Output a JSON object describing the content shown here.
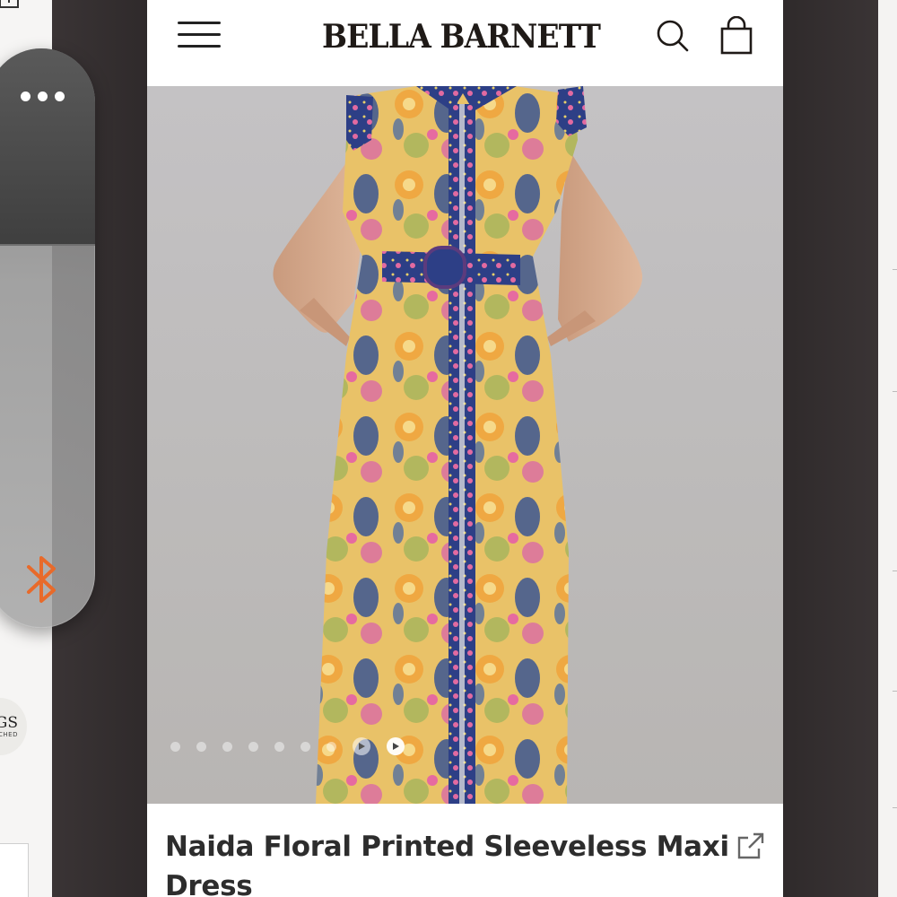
{
  "site": {
    "brand_name": "BELLA BARNETT"
  },
  "product": {
    "title": "Naida Floral Printed Sleeveless Maxi Dress",
    "gallery": {
      "image_alt": "Model wearing floral printed sleeveless maxi dress with belt",
      "total_images": 7,
      "video_items": 2
    }
  },
  "background_app": {
    "badge_main": "GS",
    "badge_sub": "CHED"
  },
  "colors": {
    "brand_text": "#1f1a17",
    "bluetooth_accent": "#e86a2a",
    "page_bg": "#ffffff",
    "gallery_bg": "#bfbdbc"
  },
  "icons": {
    "menu": "hamburger-icon",
    "search": "search-icon",
    "cart": "shopping-bag-icon",
    "share": "external-link-icon",
    "more": "more-dots-icon",
    "bluetooth": "bluetooth-icon"
  }
}
